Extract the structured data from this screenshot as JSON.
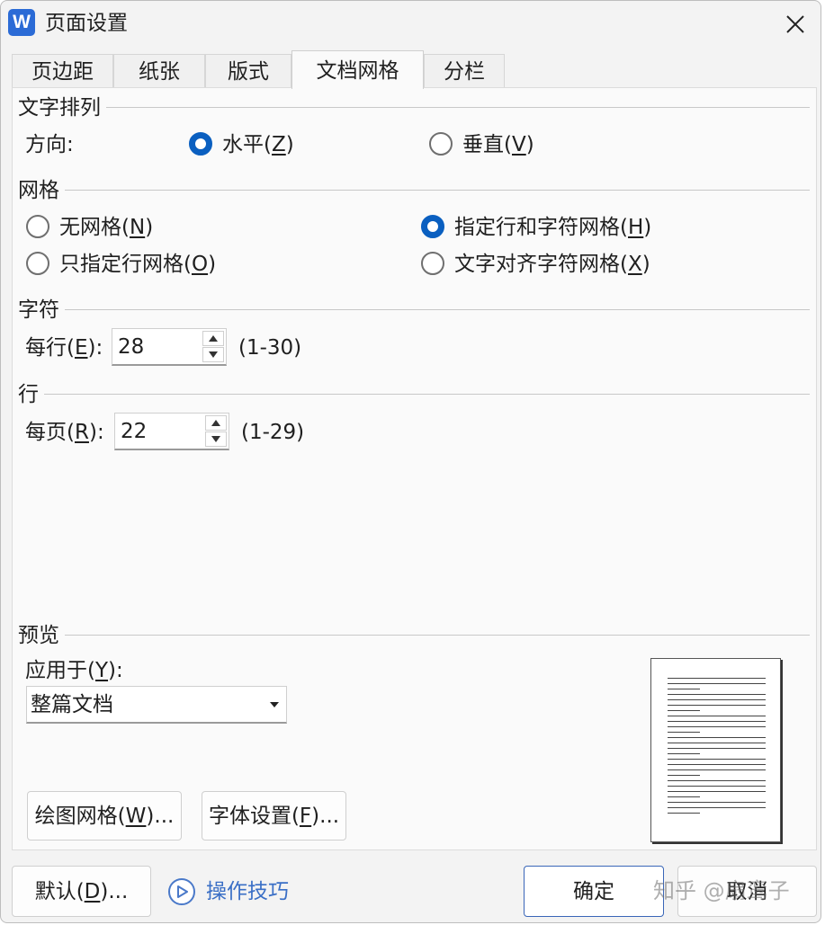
{
  "window": {
    "title": "页面设置",
    "app_logo": "W",
    "close_icon": "close-icon"
  },
  "tabs": [
    {
      "label": "页边距",
      "active": false
    },
    {
      "label": "纸张",
      "active": false
    },
    {
      "label": "版式",
      "active": false
    },
    {
      "label": "文档网格",
      "active": true
    },
    {
      "label": "分栏",
      "active": false
    }
  ],
  "text_direction": {
    "section_title": "文字排列",
    "direction_label": "方向:",
    "horizontal": {
      "text": "水平(",
      "key": "Z",
      "end": ")",
      "checked": true
    },
    "vertical": {
      "text": "垂直(",
      "key": "V",
      "end": ")",
      "checked": false
    }
  },
  "grid": {
    "section_title": "网格",
    "options": [
      {
        "text": "无网格(",
        "key": "N",
        "end": ")",
        "checked": false
      },
      {
        "text": "只指定行网格(",
        "key": "O",
        "end": ")",
        "checked": false
      },
      {
        "text": "指定行和字符网格(",
        "key": "H",
        "end": ")",
        "checked": true
      },
      {
        "text": "文字对齐字符网格(",
        "key": "X",
        "end": ")",
        "checked": false
      }
    ]
  },
  "characters": {
    "section_title": "字符",
    "per_line_text": "每行(",
    "per_line_key": "E",
    "per_line_end": "):",
    "value": "28",
    "range": "(1-30)"
  },
  "lines": {
    "section_title": "行",
    "per_page_text": "每页(",
    "per_page_key": "R",
    "per_page_end": "):",
    "value": "22",
    "range": "(1-29)"
  },
  "preview": {
    "section_title": "预览",
    "apply_to_text": "应用于(",
    "apply_to_key": "Y",
    "apply_to_end": "):",
    "apply_to_value": "整篇文档"
  },
  "buttons": {
    "draw_grid": {
      "text": "绘图网格(",
      "key": "W",
      "end": ")..."
    },
    "font_settings": {
      "text": "字体设置(",
      "key": "F",
      "end": ")..."
    },
    "default": {
      "text": "默认(",
      "key": "D",
      "end": ")..."
    },
    "tips": "操作技巧",
    "ok": "确定",
    "cancel": "取消"
  },
  "accent_color": "#0a5fc0",
  "watermark": "知乎 @扇鸾子"
}
